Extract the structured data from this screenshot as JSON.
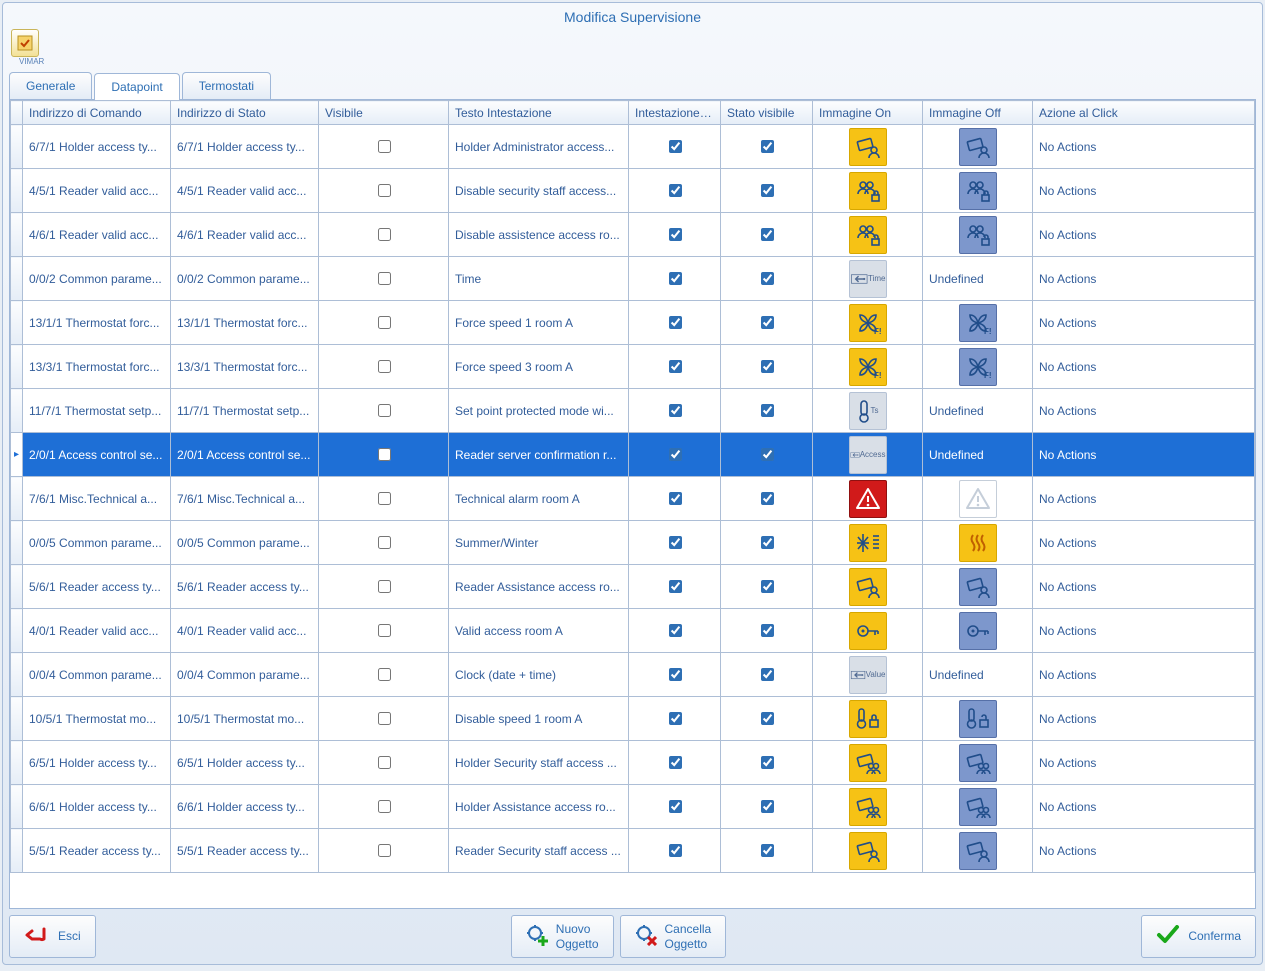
{
  "window": {
    "title": "Modifica Supervisione",
    "brand": "VIMAR"
  },
  "tabs": [
    {
      "label": "Generale",
      "active": false
    },
    {
      "label": "Datapoint",
      "active": true
    },
    {
      "label": "Termostati",
      "active": false
    }
  ],
  "columns": {
    "indicator": "",
    "cmd_addr": "Indirizzo di Comando",
    "stat_addr": "Indirizzo di Stato",
    "visible": "Visibile",
    "heading_text": "Testo Intestazione",
    "heading_visible": "Intestazione Vi...",
    "state_visible": "Stato visibile",
    "img_on": "Immagine On",
    "img_off": "Immagine Off",
    "click_action": "Azione al Click"
  },
  "rows": [
    {
      "cmd": "6/7/1 Holder access ty...",
      "stat": "6/7/1 Holder access ty...",
      "vis": false,
      "head": "Holder Administrator access...",
      "hv": true,
      "sv": true,
      "on": {
        "bg": "yellow",
        "glyph": "card-person"
      },
      "off": {
        "bg": "blue",
        "glyph": "card-person"
      },
      "action": "No Actions"
    },
    {
      "cmd": "4/5/1 Reader valid acc...",
      "stat": "4/5/1 Reader valid acc...",
      "vis": false,
      "head": "Disable security staff access...",
      "hv": true,
      "sv": true,
      "on": {
        "bg": "yellow",
        "glyph": "people-lock"
      },
      "off": {
        "bg": "blue",
        "glyph": "people-lock"
      },
      "action": "No Actions"
    },
    {
      "cmd": "4/6/1 Reader valid acc...",
      "stat": "4/6/1 Reader valid acc...",
      "vis": false,
      "head": "Disable assistence access ro...",
      "hv": true,
      "sv": true,
      "on": {
        "bg": "yellow",
        "glyph": "people-unlock"
      },
      "off": {
        "bg": "blue",
        "glyph": "people-unlock"
      },
      "action": "No Actions"
    },
    {
      "cmd": "0/0/2 Common parame...",
      "stat": "0/0/2 Common parame...",
      "vis": false,
      "head": "Time",
      "hv": true,
      "sv": true,
      "on": {
        "bg": "gray",
        "glyph": "arrow-time",
        "sub": "Time"
      },
      "off": {
        "text": "Undefined"
      },
      "action": "No Actions"
    },
    {
      "cmd": "13/1/1 Thermostat forc...",
      "stat": "13/1/1 Thermostat forc...",
      "vis": false,
      "head": "Force speed 1 room A",
      "hv": true,
      "sv": true,
      "on": {
        "bg": "yellow",
        "glyph": "fan-f"
      },
      "off": {
        "bg": "blue",
        "glyph": "fan-f"
      },
      "action": "No Actions"
    },
    {
      "cmd": "13/3/1 Thermostat forc...",
      "stat": "13/3/1 Thermostat forc...",
      "vis": false,
      "head": "Force speed 3 room A",
      "hv": true,
      "sv": true,
      "on": {
        "bg": "yellow",
        "glyph": "fan-f"
      },
      "off": {
        "bg": "blue",
        "glyph": "fan-f"
      },
      "action": "No Actions"
    },
    {
      "cmd": "11/7/1 Thermostat setp...",
      "stat": "11/7/1 Thermostat setp...",
      "vis": false,
      "head": "Set point protected mode wi...",
      "hv": true,
      "sv": true,
      "on": {
        "bg": "gray",
        "glyph": "thermo",
        "sub": "Ts"
      },
      "off": {
        "text": "Undefined"
      },
      "action": "No Actions"
    },
    {
      "cmd": "2/0/1 Access control se...",
      "stat": "2/0/1 Access control se...",
      "vis": false,
      "head": "Reader server confirmation r...",
      "hv": true,
      "sv": true,
      "on": {
        "bg": "gray",
        "glyph": "arrow-time",
        "sub": "Access"
      },
      "off": {
        "text": "Undefined"
      },
      "action": "No Actions",
      "selected": true
    },
    {
      "cmd": "7/6/1 Misc.Technical a...",
      "stat": "7/6/1 Misc.Technical a...",
      "vis": false,
      "head": "Technical alarm room A",
      "hv": true,
      "sv": true,
      "on": {
        "bg": "red",
        "glyph": "alert"
      },
      "off": {
        "bg": "white",
        "glyph": "alert"
      },
      "action": "No Actions"
    },
    {
      "cmd": "0/0/5 Common parame...",
      "stat": "0/0/5 Common parame...",
      "vis": false,
      "head": "Summer/Winter",
      "hv": true,
      "sv": true,
      "on": {
        "bg": "yellow",
        "glyph": "snow"
      },
      "off": {
        "bg": "yellow",
        "glyph": "heat"
      },
      "action": "No Actions"
    },
    {
      "cmd": "5/6/1 Reader access ty...",
      "stat": "5/6/1 Reader access ty...",
      "vis": false,
      "head": "Reader Assistance access ro...",
      "hv": true,
      "sv": true,
      "on": {
        "bg": "yellow",
        "glyph": "card-person"
      },
      "off": {
        "bg": "blue",
        "glyph": "card-person"
      },
      "action": "No Actions"
    },
    {
      "cmd": "4/0/1 Reader valid acc...",
      "stat": "4/0/1 Reader valid acc...",
      "vis": false,
      "head": "Valid access room A",
      "hv": true,
      "sv": true,
      "on": {
        "bg": "yellow",
        "glyph": "key"
      },
      "off": {
        "bg": "blue",
        "glyph": "key"
      },
      "action": "No Actions"
    },
    {
      "cmd": "0/0/4 Common parame...",
      "stat": "0/0/4 Common parame...",
      "vis": false,
      "head": "Clock (date + time)",
      "hv": true,
      "sv": true,
      "on": {
        "bg": "gray",
        "glyph": "arrow-time",
        "sub": "Value"
      },
      "off": {
        "text": "Undefined"
      },
      "action": "No Actions"
    },
    {
      "cmd": "10/5/1 Thermostat mo...",
      "stat": "10/5/1 Thermostat mo...",
      "vis": false,
      "head": "Disable speed 1 room A",
      "hv": true,
      "sv": true,
      "on": {
        "bg": "yellow",
        "glyph": "thermo-lock"
      },
      "off": {
        "bg": "blue",
        "glyph": "thermo-unlock"
      },
      "action": "No Actions"
    },
    {
      "cmd": "6/5/1 Holder access ty...",
      "stat": "6/5/1 Holder access ty...",
      "vis": false,
      "head": "Holder Security staff access ...",
      "hv": true,
      "sv": true,
      "on": {
        "bg": "yellow",
        "glyph": "card-people"
      },
      "off": {
        "bg": "blue",
        "glyph": "card-people"
      },
      "action": "No Actions"
    },
    {
      "cmd": "6/6/1 Holder access ty...",
      "stat": "6/6/1 Holder access ty...",
      "vis": false,
      "head": "Holder Assistance access ro...",
      "hv": true,
      "sv": true,
      "on": {
        "bg": "yellow",
        "glyph": "card-people"
      },
      "off": {
        "bg": "blue",
        "glyph": "card-people"
      },
      "action": "No Actions"
    },
    {
      "cmd": "5/5/1 Reader access ty...",
      "stat": "5/5/1 Reader access ty...",
      "vis": false,
      "head": "Reader Security staff access ...",
      "hv": true,
      "sv": true,
      "on": {
        "bg": "yellow",
        "glyph": "card-person"
      },
      "off": {
        "bg": "blue",
        "glyph": "card-person"
      },
      "action": "No Actions"
    }
  ],
  "footer": {
    "exit": "Esci",
    "new_object_l1": "Nuovo",
    "new_object_l2": "Oggetto",
    "delete_object_l1": "Cancella",
    "delete_object_l2": "Oggetto",
    "confirm": "Conferma"
  }
}
